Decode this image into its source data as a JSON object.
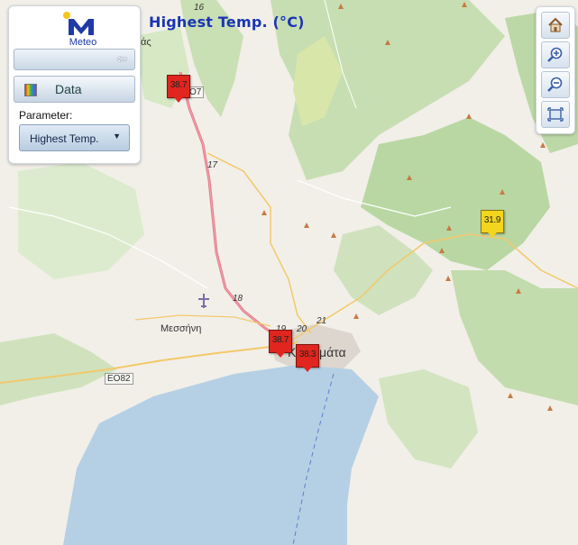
{
  "map": {
    "title": "Highest Temp. (°C)",
    "labels": [
      {
        "text": "Μεσσήνη",
        "name": "place-label-messini"
      },
      {
        "text": "Κ",
        "name": "place-label-kalamata-start"
      },
      {
        "text": "μάτα",
        "name": "place-label-kalamata-end"
      },
      {
        "text": "ΕΟ82",
        "name": "road-label-eo82"
      },
      {
        "text": "Ο7",
        "name": "road-label-o7"
      },
      {
        "text": "άς",
        "name": "place-label-partial"
      }
    ],
    "road_numbers": [
      "16",
      "17",
      "18",
      "19",
      "20",
      "21"
    ],
    "markers": [
      {
        "value": "38.7",
        "color": "#e0261e",
        "name": "temp-marker-north"
      },
      {
        "value": "31.9",
        "color": "#f2d51c",
        "name": "temp-marker-east"
      },
      {
        "value": "38.7",
        "color": "#e0261e",
        "name": "temp-marker-kalamata-west"
      },
      {
        "value": "38.3",
        "color": "#e0261e",
        "name": "temp-marker-kalamata-east"
      }
    ]
  },
  "panel": {
    "logo_text": "Meteo",
    "data_label": "Data",
    "parameter_label": "Parameter:",
    "parameter_value": "Highest Temp."
  },
  "tools": {
    "items": [
      {
        "name": "home-icon"
      },
      {
        "name": "zoom-in-icon"
      },
      {
        "name": "zoom-out-icon"
      },
      {
        "name": "full-extent-icon"
      }
    ]
  },
  "colors": {
    "sea": "#b5d0e4",
    "land": "#f1efe8",
    "forest": "#b8d6a4",
    "road_major": "#e47b8b",
    "road_minor": "#f4c86b",
    "title": "#1a35b4"
  }
}
